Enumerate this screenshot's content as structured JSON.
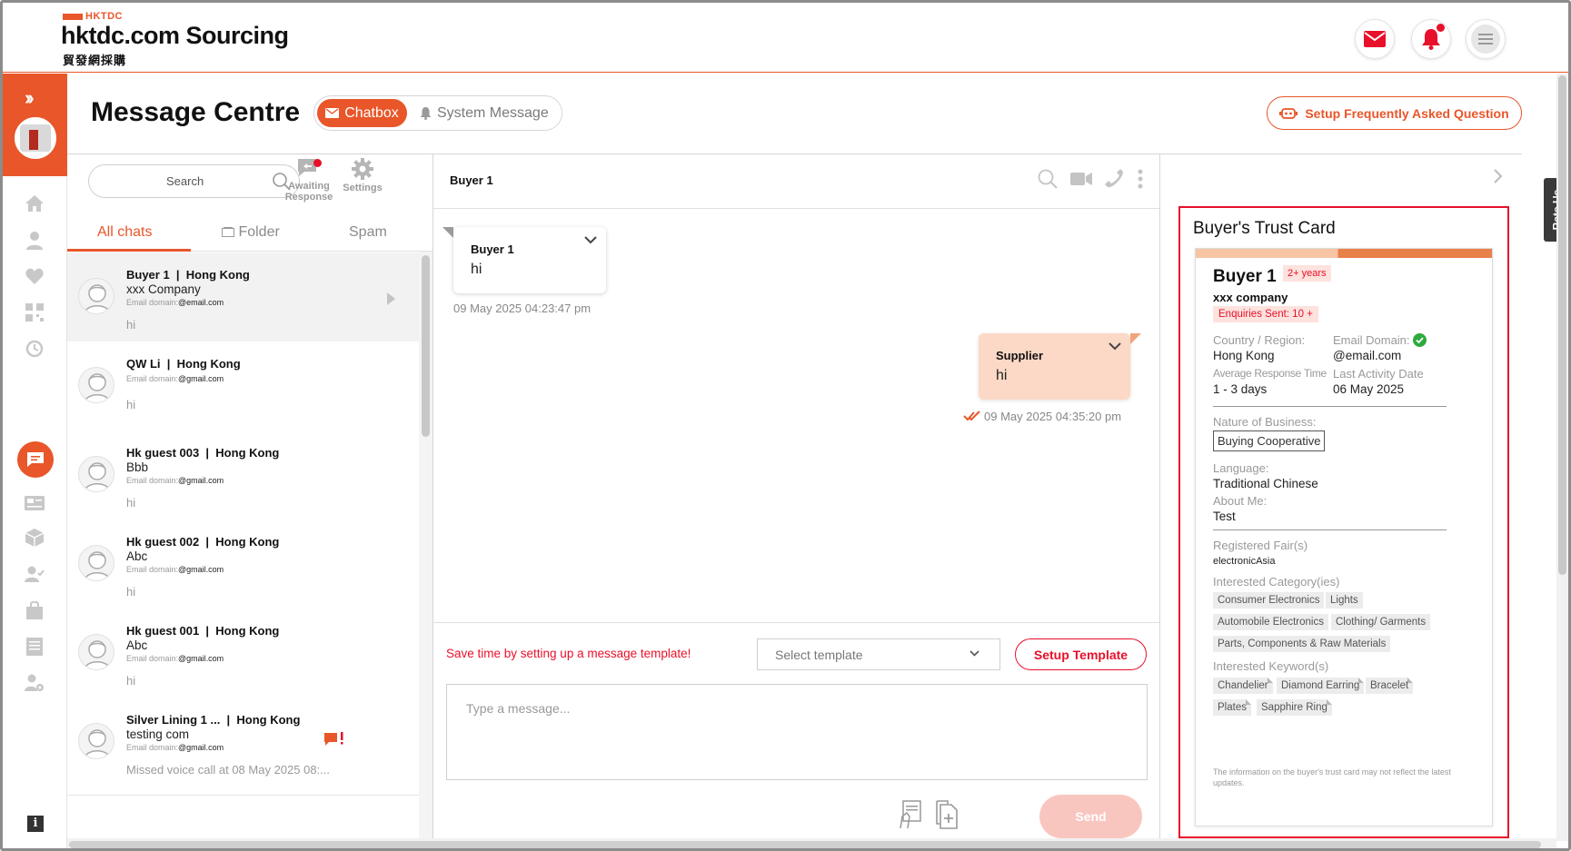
{
  "brand": {
    "small": "HKTDC",
    "name": "hktdc.com Sourcing",
    "sub": "貿發網採購",
    "accent": "#e8562a"
  },
  "header": {
    "icons": [
      "mail-icon",
      "bell-icon",
      "menu-icon"
    ]
  },
  "sidebar": {
    "items": [
      "home-icon",
      "user-icon",
      "heart-icon",
      "qr-code-icon",
      "history-icon",
      "message-icon",
      "news-icon",
      "box-icon",
      "user-check-icon",
      "bag-icon",
      "list-icon",
      "users-settings-icon"
    ],
    "info": "i"
  },
  "page": {
    "title": "Message Centre",
    "tab_chatbox": "Chatbox",
    "tab_system": "System Message",
    "faq_button": "Setup Frequently Asked Question"
  },
  "list": {
    "search_placeholder": "Search",
    "awaiting_label": "Awaiting Response",
    "settings_label": "Settings",
    "tabs": [
      "All chats",
      "Folder",
      "Spam"
    ],
    "chats": [
      {
        "name": "Buyer 1",
        "region": "Hong Kong",
        "company": "xxx Company",
        "email_label": "Email domain:",
        "email": "@email.com",
        "message": "hi"
      },
      {
        "name": "QW Li",
        "region": "Hong Kong",
        "company": "",
        "email_label": "Email domain:",
        "email": "@gmail.com",
        "message": "hi"
      },
      {
        "name": "Hk guest 003",
        "region": "Hong Kong",
        "company": "Bbb",
        "email_label": "Email domain:",
        "email": "@gmail.com",
        "message": "hi"
      },
      {
        "name": "Hk guest 002",
        "region": "Hong Kong",
        "company": "Abc",
        "email_label": "Email domain:",
        "email": "@gmail.com",
        "message": "hi"
      },
      {
        "name": "Hk guest 001",
        "region": "Hong Kong",
        "company": "Abc",
        "email_label": "Email domain:",
        "email": "@gmail.com",
        "message": "hi"
      },
      {
        "name": "Silver Lining 1 ...",
        "region": "Hong Kong",
        "company": "testing com",
        "email_label": "Email domain:",
        "email": "@gmail.com",
        "message": "Missed voice call at 08 May 2025 08:..."
      }
    ]
  },
  "conversation": {
    "header_name": "Buyer 1",
    "messages": [
      {
        "sender": "Buyer 1",
        "text": "hi",
        "time": "09 May 2025 04:23:47 pm"
      },
      {
        "sender": "Supplier",
        "text": "hi",
        "time": "09 May 2025 04:35:20 pm"
      }
    ],
    "template_hint": "Save time by setting up a message template!",
    "template_placeholder": "Select template",
    "template_button": "Setup Template",
    "message_placeholder": "Type a message...",
    "send_label": "Send"
  },
  "trust_card": {
    "title": "Buyer's Trust Card",
    "name": "Buyer 1",
    "years": "2+ years",
    "company": "xxx company",
    "enquiries": "Enquiries Sent: 10 +",
    "country_label": "Country / Region:",
    "country": "Hong Kong",
    "email_domain_label": "Email Domain:",
    "email_domain": "@email.com",
    "response_label": "Average Response Time",
    "response": "1 - 3 days",
    "activity_label": "Last Activity Date",
    "activity": "06 May 2025",
    "nature_label": "Nature of Business:",
    "nature": "Buying Cooperative",
    "language_label": "Language:",
    "language": "Traditional Chinese",
    "about_label": "About Me:",
    "about": "Test",
    "fairs_label": "Registered Fair(s)",
    "fairs": "electronicAsia",
    "categories_label": "Interested Category(ies)",
    "categories": [
      "Consumer Electronics",
      "Lights",
      "Automobile Electronics",
      "Clothing/ Garments",
      "Parts, Components & Raw Materials"
    ],
    "keywords_label": "Interested Keyword(s)",
    "keywords": [
      "Chandelier",
      "Diamond Earring",
      "Bracelet",
      "Plates",
      "Sapphire Ring"
    ],
    "note": "The information on the buyer's trust card may not reflect the latest updates."
  },
  "rate_us": "Rate Us"
}
